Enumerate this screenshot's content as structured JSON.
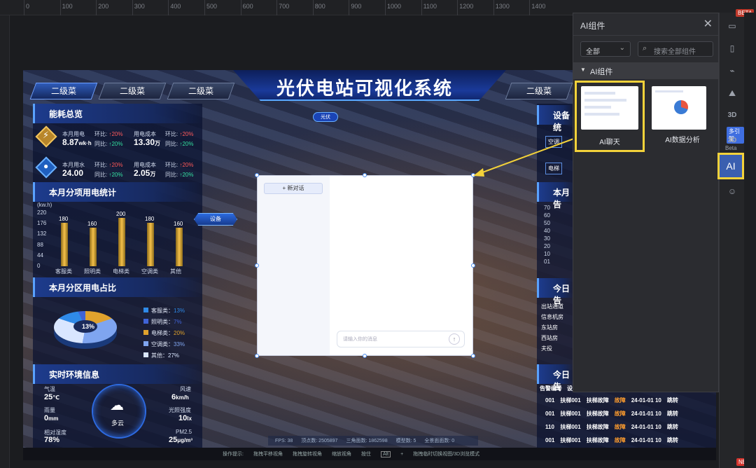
{
  "ruler": {
    "ticks": [
      "0",
      "100",
      "200",
      "300",
      "400",
      "500",
      "600",
      "700",
      "800",
      "900",
      "1000",
      "1100",
      "1200",
      "1300",
      "1400"
    ]
  },
  "dashboard": {
    "title": "光伏电站可视化系统",
    "tabs": [
      "二级菜",
      "二级菜",
      "二级菜",
      "二级菜"
    ],
    "energy": {
      "title": "能耗总览",
      "elec_label": "本月用电",
      "elec_value": "8.87",
      "elec_unit": "wk·h",
      "elec_cost_label": "用电成本",
      "elec_cost_value": "13.30",
      "elec_cost_unit": "万",
      "water_label": "本月用水",
      "water_value": "24.00",
      "water_cost_label": "用水成本",
      "water_cost_value": "2.05",
      "water_cost_unit": "万",
      "ring_label": "环比:",
      "yoy_label": "同比:",
      "up": "↑20%"
    },
    "usage": {
      "title": "本月分项用电统计",
      "unit": "(kw.h)",
      "ticks": [
        "220",
        "176",
        "132",
        "88",
        "44",
        "0"
      ],
      "device_btn": "设备"
    },
    "zone": {
      "title": "本月分区用电占比",
      "center": "13%",
      "legend": [
        {
          "label": "客服类：",
          "value": "13%",
          "color": "#2f8ae8"
        },
        {
          "label": "照明类：",
          "value": "7%",
          "color": "#3f63d6"
        },
        {
          "label": "电梯类：",
          "value": "20%",
          "color": "#e0a22d"
        },
        {
          "label": "空调类：",
          "value": "33%",
          "color": "#7fa5f0"
        },
        {
          "label": "其他：",
          "value": "27%",
          "color": "#d9e6ff"
        }
      ]
    },
    "env": {
      "title": "实时环境信息",
      "temp_label": "气温",
      "temp": "25",
      "temp_unit": "℃",
      "wind_label": "风速",
      "wind": "6",
      "wind_unit": "km/h",
      "rain_label": "雨量",
      "rain": "0",
      "rain_unit": "mm",
      "light_label": "光照强度",
      "light": "10",
      "light_unit": "lx",
      "hum_label": "相对湿度",
      "hum": "78%",
      "pm_label": "PM2.5",
      "pm": "25",
      "pm_unit": "μg/m³",
      "weather": "多云"
    },
    "right": {
      "device_title": "设备统",
      "device_items": [
        "空调",
        "电梯"
      ],
      "alarm_title": "本月告",
      "alarm_ticks": [
        "70",
        "60",
        "50",
        "40",
        "30",
        "20",
        "10",
        "01"
      ],
      "today_title": "今日告",
      "today_rows": [
        "出站通道",
        "信息机房",
        "东站房",
        "西站房",
        "夫役"
      ],
      "today2_title": "今日告",
      "col_code": "告警编号",
      "col_dev": "设"
    },
    "alarm_table": [
      [
        "001",
        "扶梯001",
        "扶梯故障",
        "故障",
        "24-01-01 10",
        "跳转"
      ],
      [
        "001",
        "扶梯001",
        "扶梯故障",
        "故障",
        "24-01-01 10",
        "跳转"
      ],
      [
        "110",
        "扶梯001",
        "扶梯故障",
        "故障",
        "24-01-01 10",
        "跳转"
      ],
      [
        "001",
        "扶梯001",
        "扶梯故障",
        "故障",
        "24-01-01 10",
        "跳转"
      ]
    ],
    "status": {
      "fps": "FPS: 38",
      "vertices": "顶点数: 2505897",
      "tris": "三角面数: 1862598",
      "models": "模型数: 5",
      "fullscreen": "全景面面数: 0",
      "hints": [
        "操作提示:",
        "拖拽平移视角",
        "拖拽旋转视角",
        "缩放视角",
        "按住",
        "Alt",
        "+",
        "拖拽临时切换视图/3D浏览模式"
      ]
    },
    "scene_label": "光伏"
  },
  "chat": {
    "new_button": "+ 新对话",
    "input_placeholder": "请输入你的消息"
  },
  "aipanel": {
    "title": "AI组件",
    "filter_value": "全部",
    "search_placeholder": "搜索全部组件",
    "group": "AI组件",
    "cards": [
      {
        "label": "AI聊天",
        "selected": true
      },
      {
        "label": "AI数据分析",
        "selected": false
      }
    ]
  },
  "iconbar": {
    "beta": "BETA",
    "hint_badge": "多引擎",
    "beta_label": "Beta",
    "ai": "AI",
    "new": "NEW"
  },
  "chart_data": {
    "type": "bar",
    "categories": [
      "客服类",
      "照明类",
      "电梯类",
      "空调类",
      "其他"
    ],
    "values": [
      180,
      160,
      200,
      180,
      160
    ],
    "ylabel": "(kw.h)",
    "ylim": [
      0,
      220
    ]
  }
}
